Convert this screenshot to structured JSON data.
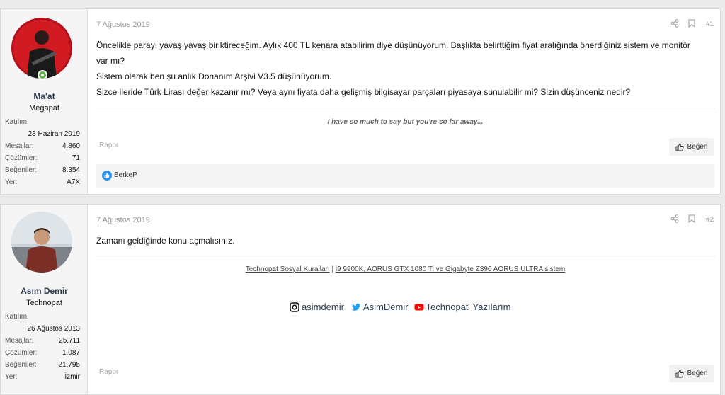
{
  "posts": [
    {
      "user": {
        "name": "Ma'at",
        "title": "Megapat",
        "online": true
      },
      "stats": [
        {
          "label": "Katılım:",
          "value": "23 Haziran 2019"
        },
        {
          "label": "Mesajlar:",
          "value": "4.860"
        },
        {
          "label": "Çözümler:",
          "value": "71"
        },
        {
          "label": "Beğeniler:",
          "value": "8.354"
        },
        {
          "label": "Yer:",
          "value": "A7X"
        }
      ],
      "date": "7 Ağustos 2019",
      "number": "#1",
      "message": [
        "Öncelikle parayı yavaş yavaş biriktireceğim. Aylık 400 TL kenara atabilirim diye düşünüyorum. Başlıkta belirttiğim fiyat aralığında önerdiğiniz sistem ve monitör var mı?",
        "Sistem olarak ben şu anlık Donanım Arşivi V3.5 düşünüyorum.",
        "Sizce ileride Türk Lirası değer kazanır mı? Veya aynı fiyata daha gelişmiş bilgisayar parçaları piyasaya sunulabilir mi? Sizin düşünceniz nedir?"
      ],
      "signature": "I have so much to say but you're so far away...",
      "report": "Rapor",
      "like": "Beğen",
      "reactions": "BerkeP"
    },
    {
      "user": {
        "name": "Asım Demir",
        "title": "Technopat",
        "online": false
      },
      "stats": [
        {
          "label": "Katılım:",
          "value": "26 Ağustos 2013"
        },
        {
          "label": "Mesajlar:",
          "value": "25.711"
        },
        {
          "label": "Çözümler:",
          "value": "1.087"
        },
        {
          "label": "Beğeniler:",
          "value": "21.795"
        },
        {
          "label": "Yer:",
          "value": "İzmir"
        }
      ],
      "date": "7 Ağustos 2019",
      "number": "#2",
      "message": [
        "Zamanı geldiğinde konu açmalısınız."
      ],
      "signature_links": {
        "rules": "Technopat Sosyal Kuralları",
        "separator": "|",
        "system": "i9 9900K, AORUS GTX 1080 Ti ve Gigabyte Z390 AORUS ULTRA sistem"
      },
      "social": {
        "instagram": "asimdemir",
        "twitter": "AsimDemir",
        "youtube": "Technopat",
        "articles": "Yazılarım"
      },
      "report": "Rapor",
      "like": "Beğen"
    }
  ],
  "icons": {
    "share": "share-icon",
    "bookmark": "bookmark-icon",
    "like": "thumbs-up-icon",
    "instagram": "instagram-icon",
    "twitter": "twitter-icon",
    "youtube": "youtube-icon"
  },
  "colors": {
    "accent": "#2d3e50",
    "online": "#63b34b",
    "twitter": "#1da1f2",
    "youtube": "#ff0000",
    "like": "#2e8fe6"
  }
}
